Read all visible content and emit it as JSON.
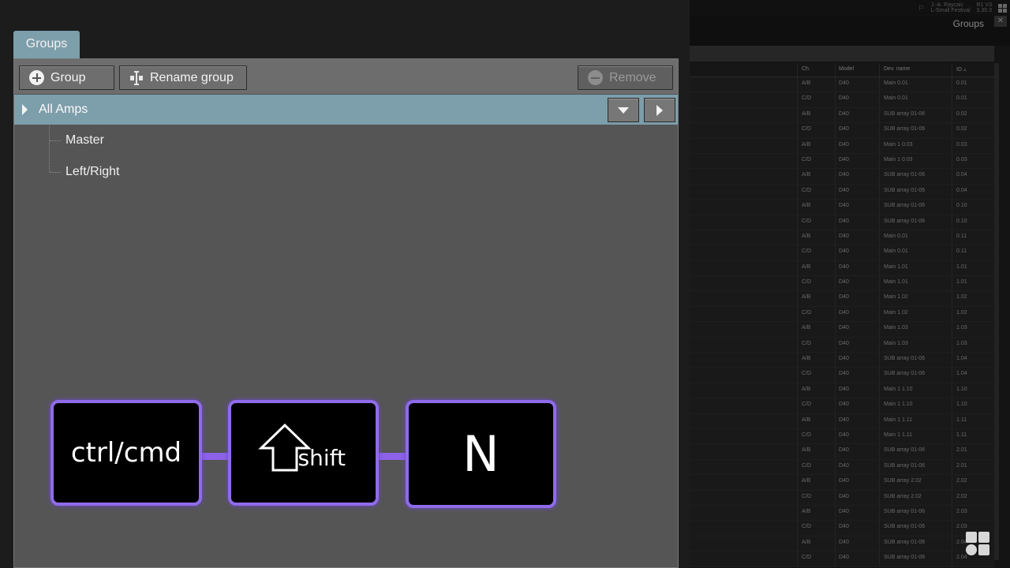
{
  "background": {
    "topbar": {
      "flag": "⚐",
      "project_line1": "J.-A. Raycaic",
      "project_line2": "L-Small Festival",
      "version_line1": "R1 V3",
      "version_line2": "3.30.3"
    },
    "title": "Groups",
    "close": "✕",
    "table": {
      "headers": [
        "Ch.",
        "Model",
        "Dev. name",
        "ID ▵"
      ],
      "rows": [
        [
          "A/B",
          "D40",
          "Main 0.01",
          "0.01"
        ],
        [
          "C/D",
          "D40",
          "Main 0.01",
          "0.01"
        ],
        [
          "A/B",
          "D40",
          "SUB array 01-06",
          "0.02"
        ],
        [
          "C/D",
          "D40",
          "SUB array 01-06",
          "0.02"
        ],
        [
          "A/B",
          "D40",
          "Main 1 0.03",
          "0.03"
        ],
        [
          "C/D",
          "D40",
          "Main 1 0.03",
          "0.03"
        ],
        [
          "A/B",
          "D40",
          "SUB array 01-06",
          "0.04"
        ],
        [
          "C/D",
          "D40",
          "SUB array 01-06",
          "0.04"
        ],
        [
          "A/B",
          "D40",
          "SUB array 01-06",
          "0.10"
        ],
        [
          "C/D",
          "D40",
          "SUB array 01-06",
          "0.10"
        ],
        [
          "A/B",
          "D40",
          "Main 0.01",
          "0.11"
        ],
        [
          "C/D",
          "D40",
          "Main 0.01",
          "0.11"
        ],
        [
          "A/B",
          "D40",
          "Main 1.01",
          "1.01"
        ],
        [
          "C/D",
          "D40",
          "Main 1.01",
          "1.01"
        ],
        [
          "A/B",
          "D40",
          "Main 1.02",
          "1.02"
        ],
        [
          "C/D",
          "D40",
          "Main 1.02",
          "1.02"
        ],
        [
          "A/B",
          "D40",
          "Main 1.03",
          "1.03"
        ],
        [
          "C/D",
          "D40",
          "Main 1.03",
          "1.03"
        ],
        [
          "A/B",
          "D40",
          "SUB array 01-06",
          "1.04"
        ],
        [
          "C/D",
          "D40",
          "SUB array 01-06",
          "1.04"
        ],
        [
          "A/B",
          "D40",
          "Main 1 1.10",
          "1.10"
        ],
        [
          "C/D",
          "D40",
          "Main 1 1.10",
          "1.10"
        ],
        [
          "A/B",
          "D40",
          "Main 1 1.11",
          "1.11"
        ],
        [
          "C/D",
          "D40",
          "Main 1 1.11",
          "1.11"
        ],
        [
          "A/B",
          "D40",
          "SUB array 01-06",
          "2.01"
        ],
        [
          "C/D",
          "D40",
          "SUB array 01-06",
          "2.01"
        ],
        [
          "A/B",
          "D40",
          "SUB array 2.02",
          "2.02"
        ],
        [
          "C/D",
          "D40",
          "SUB array 2.02",
          "2.02"
        ],
        [
          "A/B",
          "D40",
          "SUB array 01-06",
          "2.03"
        ],
        [
          "C/D",
          "D40",
          "SUB array 01-06",
          "2.03"
        ],
        [
          "A/B",
          "D40",
          "SUB array 01-06",
          "2.04"
        ],
        [
          "C/D",
          "D40",
          "SUB array 01-06",
          "2.04"
        ]
      ]
    }
  },
  "panel": {
    "tab_label": "Groups",
    "toolbar": {
      "group_label": "Group",
      "rename_label": "Rename group",
      "remove_label": "Remove"
    },
    "group_row": {
      "label": "All Amps"
    },
    "tree": [
      {
        "label": "Master"
      },
      {
        "label": "Left/Right"
      }
    ]
  },
  "shortcut": {
    "key1": "ctrl/cmd",
    "key2": "shift",
    "key3": "N",
    "accent_color": "#8f6bea"
  },
  "colors": {
    "selection": "#7d9eab",
    "panel_bg": "#555555"
  }
}
